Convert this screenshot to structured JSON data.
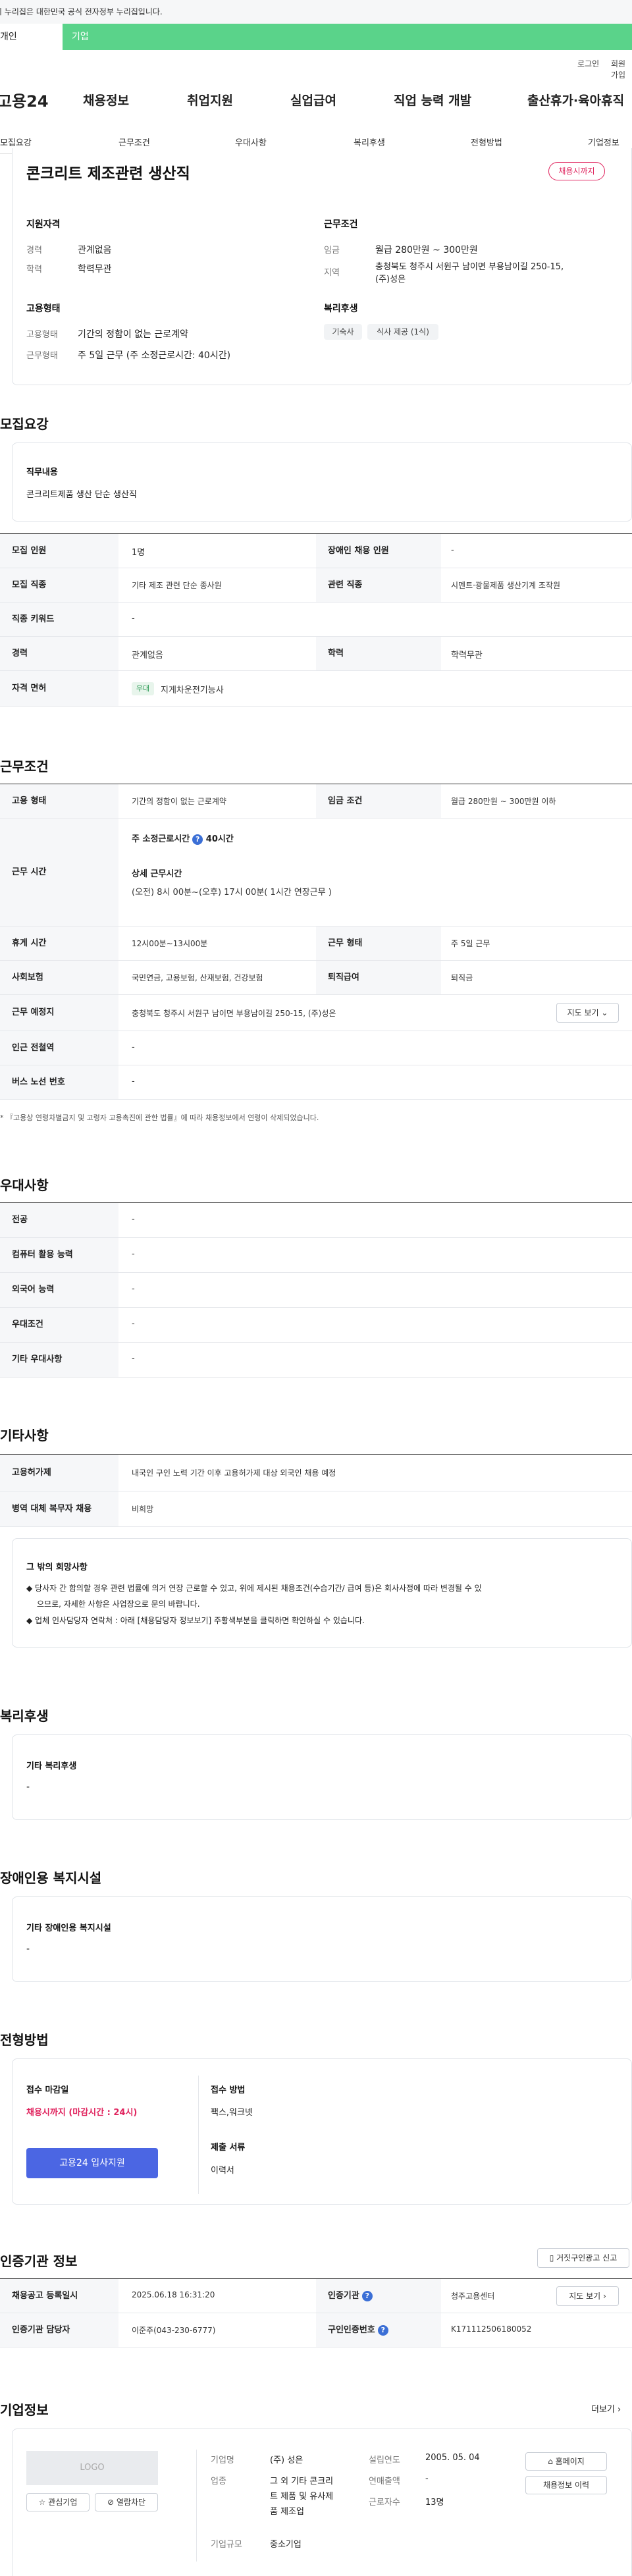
{
  "gov_notice": "이 누리집은 대한민국 공식 전자정부 누리집입니다.",
  "top_tabs": {
    "person": "개인",
    "corp": "기업"
  },
  "utility": {
    "login": "로그인",
    "signup": "회원가입"
  },
  "gnb": {
    "logo": "고용24",
    "items": [
      "채용정보",
      "취업지원",
      "실업급여",
      "직업 능력 개발",
      "출산휴가·육아휴직"
    ]
  },
  "snb": [
    "모집요강",
    "근무조건",
    "우대사항",
    "복리후생",
    "전형방법",
    "기업정보"
  ],
  "job": {
    "title": "콘크리트 제조관련 생산직",
    "badge": "채용시까지"
  },
  "summary": {
    "qual_h": "지원자격",
    "career_l": "경력",
    "career_v": "관계없음",
    "edu_l": "학력",
    "edu_v": "학력무관",
    "cond_h": "근무조건",
    "wage_l": "임금",
    "wage_v": "월급 280만원 ~ 300만원",
    "area_l": "지역",
    "area_v1": "충청북도 청주시 서원구 남이면 부용남이길 250-15,",
    "area_v2": "(주)성은",
    "emp_h": "고용형태",
    "emp_l": "고용형태",
    "emp_v": "기간의 정함이 없는 근로계약",
    "work_l": "근무형태",
    "work_v": "주 5일 근무 (주 소정근로시간: 40시간)",
    "wel_h": "복리후생",
    "wel_chips": [
      "기숙사",
      "식사 제공 (1식)"
    ]
  },
  "recruit": {
    "title": "모집요강",
    "duty_h": "직무내용",
    "duty_v": "콘크리트제품 생산 단순 생산직",
    "rows": [
      {
        "l1": "모집 인원",
        "v1": "1명",
        "l2": "장애인 채용 인원",
        "v2": "-"
      },
      {
        "l1": "모집 직종",
        "v1": "기타 제조 관련 단순 종사원",
        "l2": "관련 직종",
        "v2": "시멘트·광물제품 생산기계 조작원"
      },
      {
        "l1": "직종 키워드",
        "v1": "-"
      },
      {
        "l1": "경력",
        "v1": "관계없음",
        "l2": "학력",
        "v2": "학력무관"
      },
      {
        "l1": "자격 면허",
        "chip": "우대",
        "v1": "지게차운전기능사"
      }
    ]
  },
  "conditions": {
    "title": "근무조건",
    "emp_type_l": "고용 형태",
    "emp_type_v": "기간의 정함이 없는 근로계약",
    "wage_l": "임금 조건",
    "wage_v": "월급 280만원 ~ 300만원 이하",
    "hours_l": "근무 시간",
    "hours_main": "주 소정근로시간",
    "hours_val": "40시간",
    "hours_detail_h": "상세 근무시간",
    "hours_detail_v": "(오전) 8시 00분~(오후) 17시 00분( 1시간 연장근무 )",
    "break_l": "휴게 시간",
    "break_v": "12시00분~13시00분",
    "form_l": "근무 형태",
    "form_v": "주 5일 근무",
    "ins_l": "사회보험",
    "ins_v": "국민연금, 고용보험, 산재보험, 건강보험",
    "sev_l": "퇴직급여",
    "sev_v": "퇴직금",
    "loc_l": "근무 예정지",
    "loc_v": "충청북도 청주시 서원구 남이면 부용남이길 250-15, (주)성은",
    "map_btn": "지도 보기",
    "subway_l": "인근 전철역",
    "subway_v": "-",
    "bus_l": "버스 노선 번호",
    "bus_v": "-",
    "note": "* 『고용상 연령차별금지 및 고령자 고용촉진에 관한 법률』에 따라 채용정보에서 연령이 삭제되었습니다."
  },
  "pref": {
    "title": "우대사항",
    "rows": [
      {
        "l": "전공",
        "v": "-"
      },
      {
        "l": "컴퓨터 활용 능력",
        "v": "-"
      },
      {
        "l": "외국어 능력",
        "v": "-"
      },
      {
        "l": "우대조건",
        "v": "-"
      },
      {
        "l": "기타 우대사항",
        "v": "-"
      }
    ]
  },
  "etc": {
    "title": "기타사항",
    "rows": [
      {
        "l": "고용허가제",
        "v": "내국인 구인 노력 기간 이후 고용허가제 대상 외국인 채용 예정"
      },
      {
        "l": "병역 대체 복무자 채용",
        "v": "비희망"
      }
    ],
    "box_h": "그 밖의 희망사항",
    "box_l1": "◆ 당사자 간 합의할 경우 관련 법률에 의거 연장 근로할 수 있고, 위에 제시된 채용조건(수습기간/ 급여 등)은 회사사정에 따라 변경될 수 있",
    "box_l2": "으므로, 자세한 사항은 사업장으로 문의 바랍니다.",
    "box_l3": "◆ 업체 인사담당자 연락처 : 아래 [채용담당자 정보보기] 주황색부분을 클릭하면 확인하실 수 있습니다."
  },
  "welfare": {
    "title": "복리후생",
    "h": "기타 복리후생",
    "v": "-"
  },
  "disabled": {
    "title": "장애인용 복지시설",
    "h": "기타 장애인용 복지시설",
    "v": "-"
  },
  "selection": {
    "title": "전형방법",
    "deadline_h": "접수 마감일",
    "deadline_v": "채용시까지 (마감시간 : 24시)",
    "method_h": "접수 방법",
    "method_v": "팩스,워크넷",
    "docs_h": "제출 서류",
    "docs_v": "이력서",
    "apply_btn": "고용24 입사지원"
  },
  "cert": {
    "title": "인증기관 정보",
    "report_btn": "거짓구인광고 신고",
    "reg_l": "채용공고 등록일시",
    "reg_v": "2025.06.18 16:31:20",
    "org_l": "인증기관",
    "org_v": "청주고용센터",
    "map_btn": "지도 보기",
    "mgr_l": "인증기관 담당자",
    "mgr_v": "이준주(043-230-6777)",
    "no_l": "구인인증번호",
    "no_v": "K171112506180052"
  },
  "company": {
    "title": "기업정보",
    "more": "더보기",
    "logo_ph": "LOGO",
    "fav_btn": "관심기업",
    "block_btn": "열람차단",
    "name_l": "기업명",
    "name_v": "(주) 성은",
    "est_l": "설립연도",
    "est_v": "2005. 05. 04",
    "ind_l": "업종",
    "ind_v1": "그 외 기타 콘크리",
    "ind_v2": "트 제품 및 유사제",
    "ind_v3": "품 제조업",
    "sales_l": "연매출액",
    "sales_v": "-",
    "emp_l": "근로자수",
    "emp_v": "13명",
    "size_l": "기업규모",
    "size_v": "중소기업",
    "home_btn": "홈페이지",
    "hist_btn": "채용정보 이력"
  }
}
